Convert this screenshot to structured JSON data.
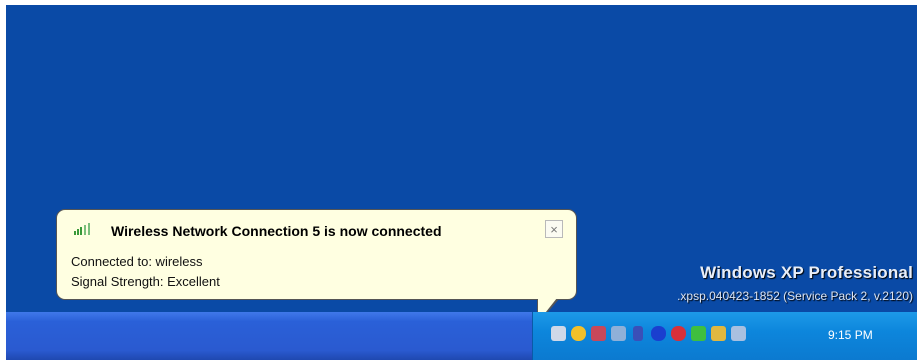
{
  "watermark": {
    "title": "Windows XP Professional",
    "build": ".xpsp.040423-1852 (Service Pack 2, v.2120)"
  },
  "balloon": {
    "icon": "wireless-signal-icon",
    "title": "Wireless Network Connection 5 is now connected",
    "close_label": "×",
    "connected_to": "Connected to: wireless",
    "signal_strength": "Signal Strength: Excellent"
  },
  "taskbar": {
    "tray_icons": [
      "network-icon",
      "security-shield-icon",
      "network-connections-icon",
      "users-icon",
      "usb-icon",
      "bluetooth-icon",
      "antivirus-icon",
      "signal-bars-icon",
      "wireless-config-icon",
      "display-icon"
    ],
    "clock": "9:15 PM"
  },
  "colors": {
    "desktop": "#0a4aa6",
    "balloon": "#ffffe1",
    "taskbar": "#2a5ad0",
    "tray": "#0c7ad0"
  }
}
